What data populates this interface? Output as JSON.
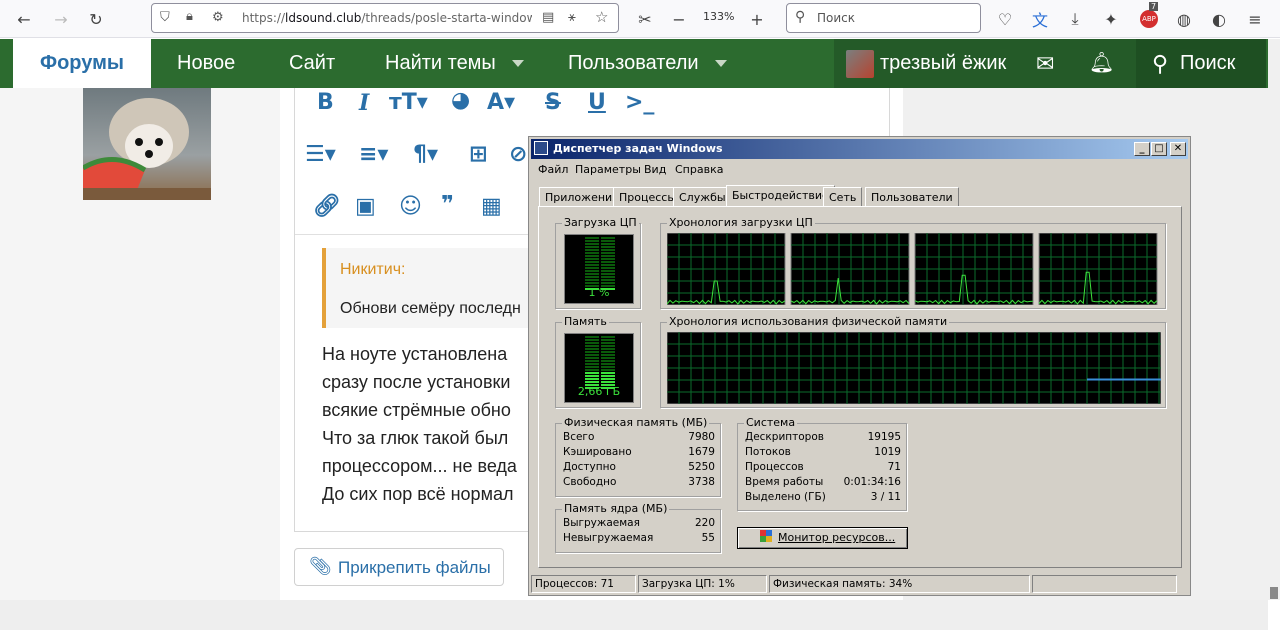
{
  "browser": {
    "url_scheme": "https://",
    "url_host": "ldsound.club",
    "url_path": "/threads/posle-starta-windows",
    "zoom": "133%",
    "search_placeholder": "Поиск",
    "badge_count": "7",
    "badge_label": "ABP"
  },
  "forum_nav": {
    "tabs": [
      "Форумы",
      "Новое",
      "Сайт",
      "Найти темы",
      "Пользователи"
    ],
    "username": "трезвый ёжик",
    "search_label": "Поиск"
  },
  "post": {
    "quote_author": "Никитич:",
    "quote_text": "Обнови семёру последн",
    "lines": [
      "На ноуте установлена",
      "сразу после установки",
      "всякие стрёмные обно",
      "Что за глюк такой был",
      "процессором... не веда",
      "До сих пор всё нормал"
    ],
    "attach_label": "Прикрепить файлы"
  },
  "taskmgr": {
    "title": "Диспетчер задач Windows",
    "menu": [
      "Файл",
      "Параметры",
      "Вид",
      "Справка"
    ],
    "tabs": [
      "Приложения",
      "Процессы",
      "Службы",
      "Быстродействие",
      "Сеть",
      "Пользователи"
    ],
    "active_tab": "Быстродействие",
    "cpu_group": "Загрузка ЦП",
    "cpu_value": "1 %",
    "cpu_history": "Хронология загрузки ЦП",
    "mem_group": "Память",
    "mem_value": "2,66 ГБ",
    "mem_history": "Хронология использования физической памяти",
    "phys_group": "Физическая память (МБ)",
    "phys_rows": [
      {
        "k": "Всего",
        "v": "7980"
      },
      {
        "k": "Кэшировано",
        "v": "1679"
      },
      {
        "k": "Доступно",
        "v": "5250"
      },
      {
        "k": "Свободно",
        "v": "3738"
      }
    ],
    "kernel_group": "Память ядра (МБ)",
    "kernel_rows": [
      {
        "k": "Выгружаемая",
        "v": "220"
      },
      {
        "k": "Невыгружаемая",
        "v": "55"
      }
    ],
    "system_group": "Система",
    "system_rows": [
      {
        "k": "Дескрипторов",
        "v": "19195"
      },
      {
        "k": "Потоков",
        "v": "1019"
      },
      {
        "k": "Процессов",
        "v": "71"
      },
      {
        "k": "Время работы",
        "v": "0:01:34:16"
      },
      {
        "k": "Выделено (ГБ)",
        "v": "3 / 11"
      }
    ],
    "resmon_button": "Монитор ресурсов...",
    "status_processes": "Процессов: 71",
    "status_cpu": "Загрузка ЦП: 1%",
    "status_mem": "Физическая память: 34%",
    "cpu_load_fraction": 0.01,
    "mem_load_fraction": 0.34
  }
}
